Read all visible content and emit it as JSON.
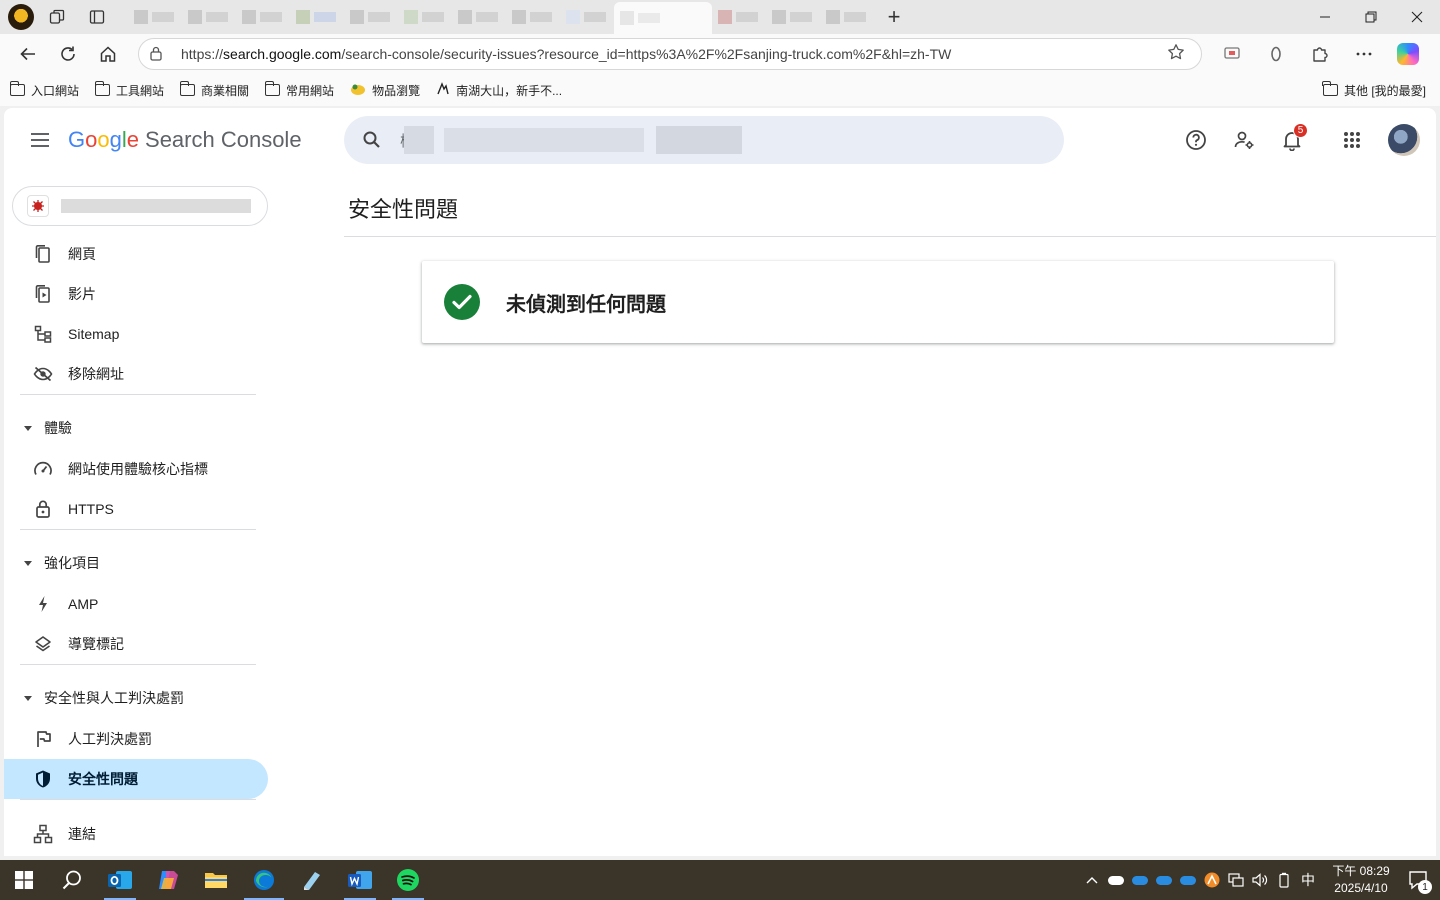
{
  "browser": {
    "url_prefix": "https://",
    "url_host": "search.google.com",
    "url_path": "/search-console/security-issues?resource_id=https%3A%2F%2Fsanjing-truck.com%2F&hl=zh-TW",
    "bookmarks": [
      {
        "label": "入口網站",
        "icon": "folder-icon"
      },
      {
        "label": "工具網站",
        "icon": "folder-icon"
      },
      {
        "label": "商業相關",
        "icon": "folder-icon"
      },
      {
        "label": "常用網站",
        "icon": "folder-icon"
      },
      {
        "label": "物品瀏覽",
        "icon": "bookmark-site-icon"
      },
      {
        "label": "南湖大山，新手不...",
        "icon": "bookmark-site-icon"
      }
    ],
    "other_bookmarks": "其他 [我的最愛]"
  },
  "app": {
    "logo_google": "Google",
    "logo_product": "Search Console",
    "search_placeholder": "檢",
    "notification_count": "5",
    "colors": {
      "accent": "#c2e7ff",
      "success": "#188038",
      "badge": "#d93025",
      "search_bg": "#e9eef6"
    }
  },
  "sidebar": {
    "items_top": [
      {
        "label": "網頁",
        "icon": "pages-icon"
      },
      {
        "label": "影片",
        "icon": "video-icon"
      },
      {
        "label": "Sitemap",
        "icon": "sitemap-icon"
      },
      {
        "label": "移除網址",
        "icon": "removal-icon"
      }
    ],
    "section_experience": "體驗",
    "items_experience": [
      {
        "label": "網站使用體驗核心指標",
        "icon": "speed-gauge-icon"
      },
      {
        "label": "HTTPS",
        "icon": "lock-icon"
      }
    ],
    "section_enhancements": "強化項目",
    "items_enhancements": [
      {
        "label": "AMP",
        "icon": "bolt-icon"
      },
      {
        "label": "導覽標記",
        "icon": "layers-icon"
      }
    ],
    "section_security": "安全性與人工判決處罰",
    "items_security": [
      {
        "label": "人工判決處罰",
        "icon": "flag-icon"
      },
      {
        "label": "安全性問題",
        "icon": "shield-icon",
        "active": true
      }
    ],
    "items_bottom": [
      {
        "label": "連結",
        "icon": "links-icon"
      }
    ]
  },
  "main": {
    "title": "安全性問題",
    "status_message": "未偵測到任何問題"
  },
  "taskbar": {
    "ime": "中",
    "time": "下午 08:29",
    "date": "2025/4/10",
    "notification_count": "1"
  }
}
